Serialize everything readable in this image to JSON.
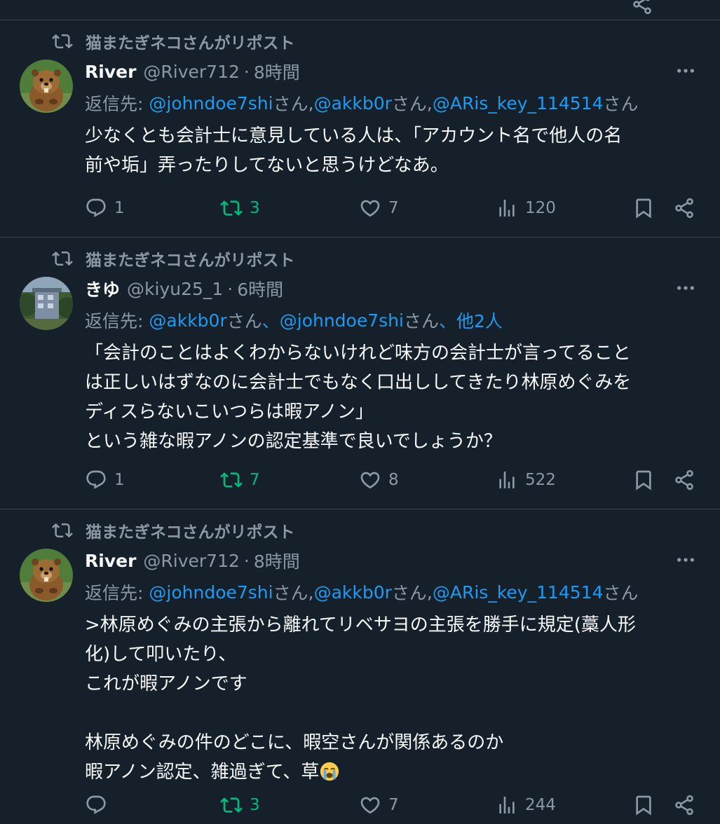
{
  "tweets": [
    {
      "repost_text": "猫またぎネコさんがリポスト",
      "name": "River",
      "handle": "@River712",
      "time": "8時間",
      "reply_prefix": "返信先: ",
      "mentions": [
        "@johndoe7shi",
        "@akkb0r",
        "@ARis_key_114514"
      ],
      "san": "さん",
      "sep": ", ",
      "body": "少なくとも会計士に意見している人は、「アカウント名で他人の名\n前や垢」弄ったりしてないと思うけどなあ。",
      "replies": "1",
      "reposts": "3",
      "likes": "7",
      "views": "120"
    },
    {
      "repost_text": "猫またぎネコさんがリポスト",
      "name": "きゆ",
      "handle": "@kiyu25_1",
      "time": "6時間",
      "reply_prefix": "返信先: ",
      "mentions": [
        "@akkb0r",
        "@johndoe7shi"
      ],
      "san": "さん",
      "sep": "、",
      "others": "他2人",
      "body": "「会計のことはよくわからないけれど味方の会計士が言ってること\nは正しいはずなのに会計士でもなく口出ししてきたり林原めぐみを\nディスらないこいつらは暇アノン」\nという雑な暇アノンの認定基準で良いでしょうか？",
      "replies": "1",
      "reposts": "7",
      "likes": "8",
      "views": "522"
    },
    {
      "repost_text": "猫またぎネコさんがリポスト",
      "name": "River",
      "handle": "@River712",
      "time": "8時間",
      "reply_prefix": "返信先: ",
      "mentions": [
        "@johndoe7shi",
        "@akkb0r",
        "@ARis_key_114514"
      ],
      "san": "さん",
      "sep": ", ",
      "body": ">林原めぐみの主張から離れてリベサヨの主張を勝手に規定(藁人形\n化)して叩いたり、\nこれが暇アノンです\n\n林原めぐみの件のどこに、暇空さんが関係あるのか\n暇アノン認定、雑過ぎて、草",
      "replies": "",
      "reposts": "3",
      "likes": "7",
      "views": "244"
    }
  ],
  "colors": {
    "background": "#15202b",
    "text": "#f7f9f9",
    "secondary": "#8b98a5",
    "link": "#1d9bf0",
    "repost_green": "#00ba7c",
    "divider": "#38444d"
  },
  "icons": [
    "repost-icon",
    "reply-icon",
    "like-icon",
    "views-icon",
    "bookmark-icon",
    "share-icon",
    "more-icon",
    "loudly-crying-face-emoji"
  ]
}
